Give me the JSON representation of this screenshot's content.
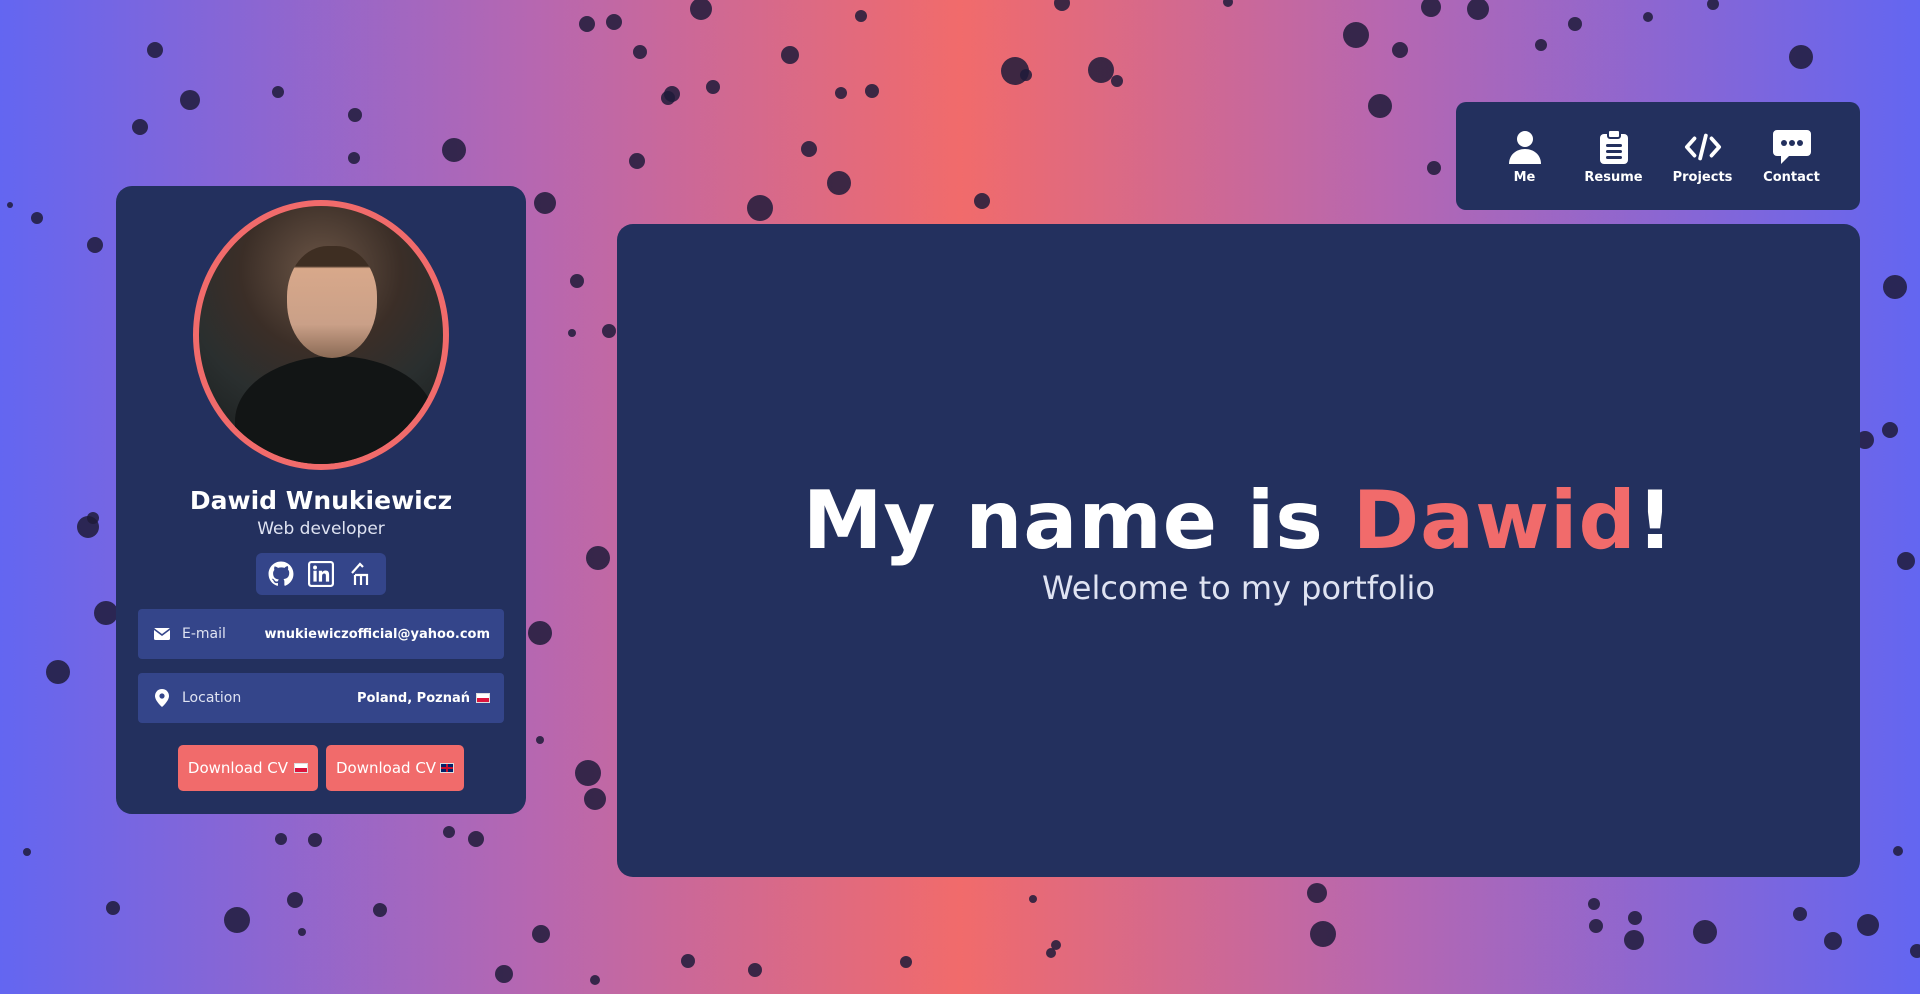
{
  "profile": {
    "name": "Dawid Wnukiewicz",
    "role": "Web developer",
    "email_label": "E-mail",
    "email_value": "wnukiewiczofficial@yahoo.com",
    "location_label": "Location",
    "location_value": "Poland, Poznań",
    "download_pl": "Download CV",
    "download_en": "Download CV",
    "socials": [
      "github-icon",
      "linkedin-icon",
      "hashnode-icon"
    ]
  },
  "nav": {
    "items": [
      {
        "label": "Me",
        "icon": "user-icon"
      },
      {
        "label": "Resume",
        "icon": "clipboard-icon"
      },
      {
        "label": "Projects",
        "icon": "code-icon"
      },
      {
        "label": "Contact",
        "icon": "chat-icon"
      }
    ]
  },
  "hero": {
    "prefix": "My name is ",
    "name": "Dawid",
    "suffix": "!",
    "subtitle": "Welcome to my portfolio"
  },
  "colors": {
    "panel": "#23305e",
    "accent": "#f16b6b",
    "row": "#34458a"
  }
}
